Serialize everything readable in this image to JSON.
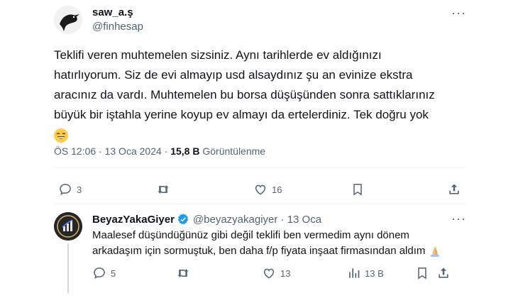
{
  "tweet": {
    "display_name": "saw_a.ş",
    "handle": "@finhesap",
    "more": "···",
    "text_lines": [
      "Teklifi veren muhtemelen sizsiniz. Aynı tarihlerde ev aldığınızı",
      "hatırlıyorum. Siz de evi almayıp usd alsaydınız şu an evinize ekstra",
      "aracınız da vardı. Muhtemelen bu borsa düşüşünden sonra sattıklarınız",
      "büyük bir iştahla  yerine koyup ev almayı da ertelerdiniz. Tek doğru yok"
    ],
    "emoji": "😂",
    "time": "ÖS 12:06 · 13 Oca 2024 · ",
    "views_count": "15,8 B",
    "views_label": " Görüntülenme",
    "actions": {
      "replies": "3",
      "retweets": "",
      "likes": "16"
    }
  },
  "reply": {
    "display_name": "BeyazYakaGiyer",
    "handle_date": "@beyazyakagiyer · 13 Oca",
    "more": "···",
    "text_lines": [
      "Maalesef düşündüğünüz gibi değil teklifi ben vermedim aynı dönem",
      "arkadaşım için sormuştuk, ben daha f/p fiyata inşaat firmasından aldım"
    ],
    "emoji": "🙏",
    "actions": {
      "replies": "5",
      "retweets": "",
      "likes": "13",
      "views": "13 B"
    }
  },
  "colors": {
    "text": "#0f1419",
    "muted": "#536471",
    "verified": "#1d9bf0",
    "divider": "#eff3f4"
  }
}
